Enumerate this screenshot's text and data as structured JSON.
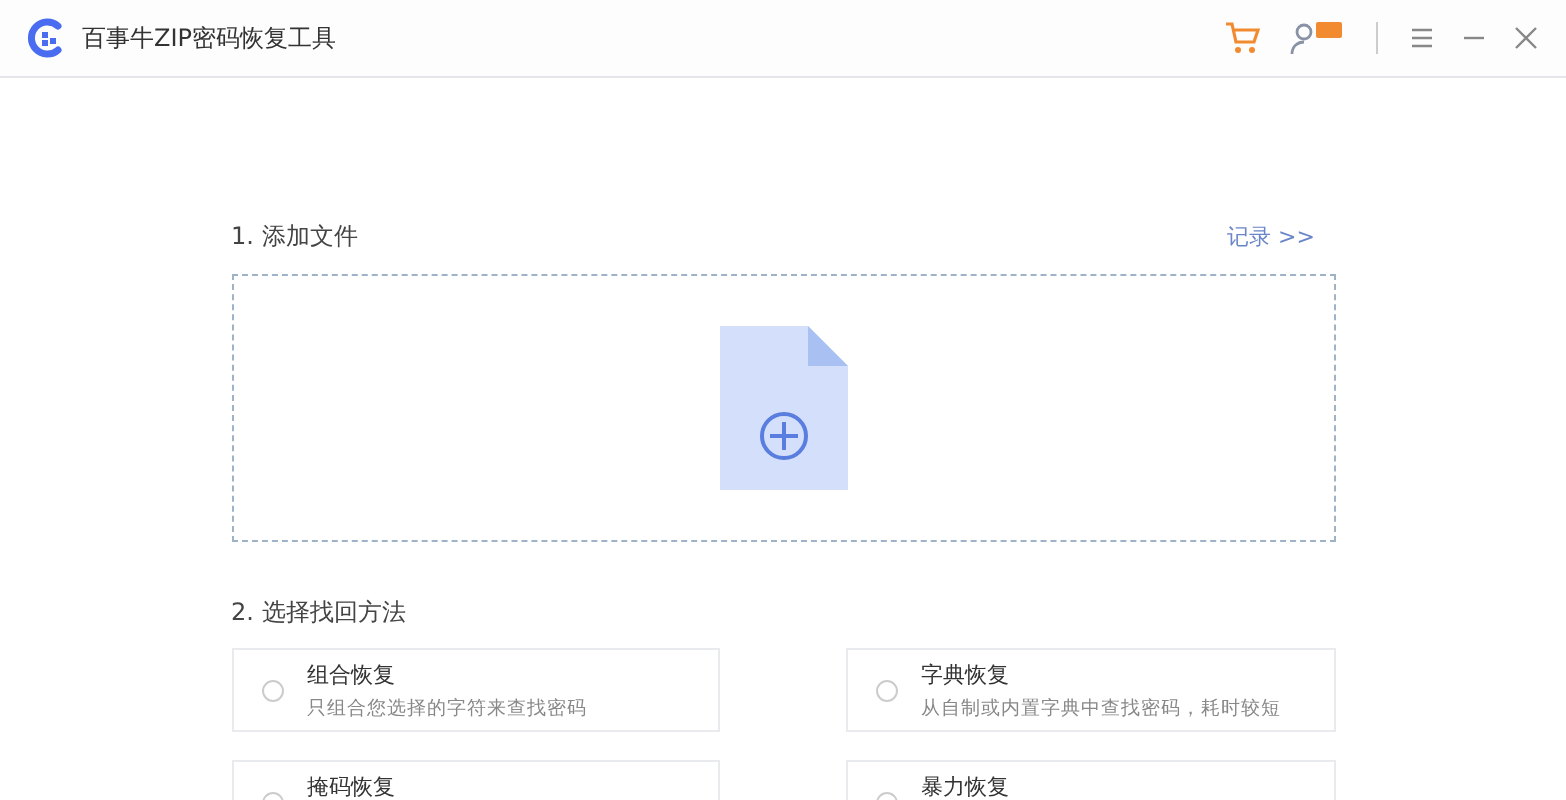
{
  "window": {
    "title": "百事牛ZIP密码恢复工具"
  },
  "section_add": {
    "title": "1. 添加文件",
    "history_link": "记录 >>"
  },
  "section_method": {
    "title": "2. 选择找回方法",
    "methods": [
      {
        "title": "组合恢复",
        "description": "只组合您选择的字符来查找密码",
        "selected": false
      },
      {
        "title": "字典恢复",
        "description": "从自制或内置字典中查找密码，耗时较短",
        "selected": false
      },
      {
        "title": "掩码恢复",
        "selected": false
      },
      {
        "title": "暴力恢复",
        "selected": false
      }
    ]
  }
}
